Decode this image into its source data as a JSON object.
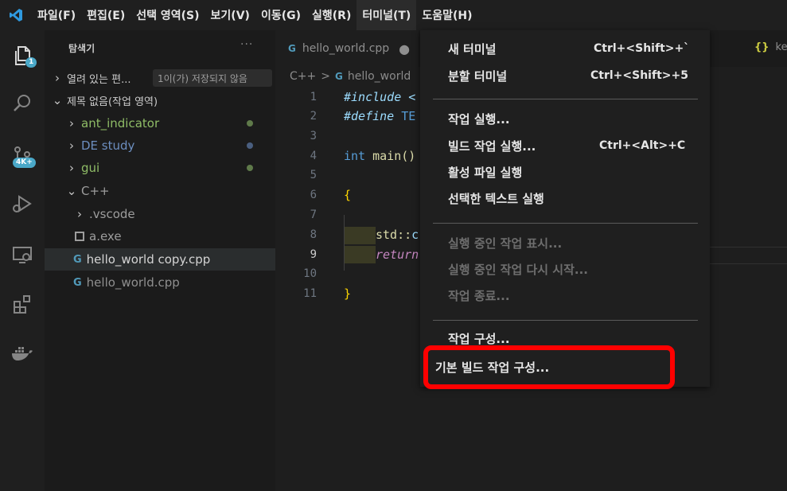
{
  "menubar": {
    "items": [
      "파일(F)",
      "편집(E)",
      "선택 영역(S)",
      "보기(V)",
      "이동(G)",
      "실행(R)",
      "터미널(T)",
      "도움말(H)"
    ],
    "active_index": 6
  },
  "activity": {
    "explorer_badge": "1",
    "scm_badge": "4K+"
  },
  "sidebar": {
    "title": "탐색기",
    "more": "···",
    "open_editors": "열려 있는 편...",
    "unsaved_tooltip": "1이(가) 저장되지 않음",
    "workspace": "제목 없음(작업 영역)",
    "folders": [
      {
        "label": "ant_indicator",
        "color": "#8fbc66"
      },
      {
        "label": "DE study",
        "color": "#6c8ebf"
      },
      {
        "label": "gui",
        "color": "#8fbc66"
      },
      {
        "label": "C++",
        "color": "#9d9d9d"
      }
    ],
    "files": [
      {
        "label": ".vscode"
      },
      {
        "label": "a.exe"
      },
      {
        "label": "hello_world copy.cpp"
      },
      {
        "label": "hello_world.cpp"
      }
    ]
  },
  "editor": {
    "tab_label": "hello_world.cpp",
    "breadcrumb_root": "C++",
    "breadcrumb_sep": ">",
    "breadcrumb_file": "hello_world",
    "right_tab": "ke",
    "line_numbers": [
      "1",
      "2",
      "3",
      "4",
      "5",
      "6",
      "7",
      "8",
      "9",
      "10",
      "11"
    ],
    "code": {
      "l1": "#include <",
      "l2a": "#define ",
      "l2b": "TE",
      "l4a": "int ",
      "l4b": "main()",
      "l6": "{",
      "l8a": "std::",
      "l8b": "c",
      "l9": "return",
      "l11": "}"
    }
  },
  "terminal_menu": {
    "items": [
      {
        "label": "새 터미널",
        "shortcut": "Ctrl+<Shift>+`",
        "disabled": false
      },
      {
        "label": "분할 터미널",
        "shortcut": "Ctrl+<Shift>+5",
        "disabled": false
      },
      {
        "label": "작업 실행...",
        "shortcut": "",
        "disabled": false
      },
      {
        "label": "빌드 작업 실행...",
        "shortcut": "Ctrl+<Alt>+C",
        "disabled": false
      },
      {
        "label": "활성 파일 실행",
        "shortcut": "",
        "disabled": false
      },
      {
        "label": "선택한 텍스트 실행",
        "shortcut": "",
        "disabled": false
      },
      {
        "label": "실행 중인 작업 표시...",
        "shortcut": "",
        "disabled": true
      },
      {
        "label": "실행 중인 작업 다시 시작...",
        "shortcut": "",
        "disabled": true
      },
      {
        "label": "작업 종료...",
        "shortcut": "",
        "disabled": true
      },
      {
        "label": "작업 구성...",
        "shortcut": "",
        "disabled": false
      },
      {
        "label": "기본 빌드 작업 구성...",
        "shortcut": "",
        "disabled": false
      }
    ]
  },
  "colors": {
    "accent": "#4aa8c8",
    "highlight": "#ff0000"
  }
}
